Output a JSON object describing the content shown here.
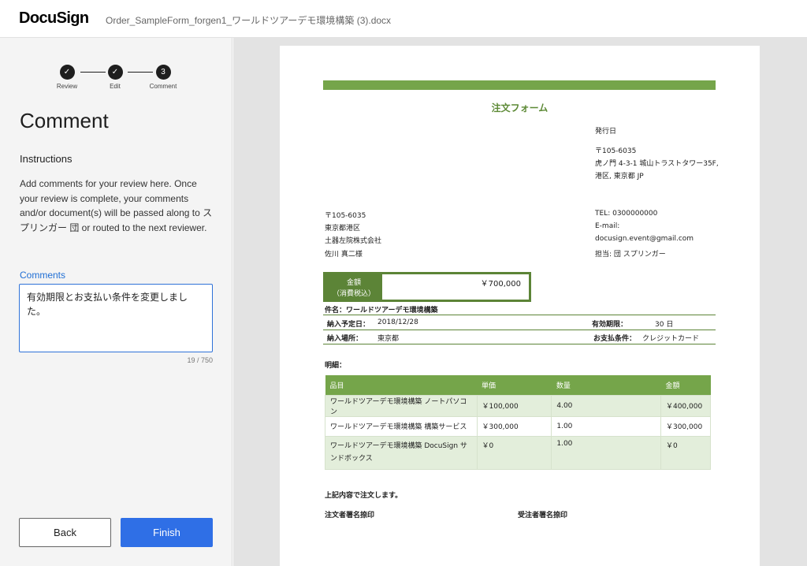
{
  "header": {
    "logo": "DocuSign",
    "filename": "Order_SampleForm_forgen1_ワールドツアーデモ環境構築 (3).docx"
  },
  "stepper": {
    "steps": [
      {
        "label": "Review",
        "state": "done",
        "glyph": "✓"
      },
      {
        "label": "Edit",
        "state": "done",
        "glyph": "✓"
      },
      {
        "label": "Comment",
        "state": "current",
        "glyph": "3"
      }
    ]
  },
  "sidebar": {
    "title": "Comment",
    "instructions_heading": "Instructions",
    "instructions": "Add comments for your review here. Once your review is complete, your comments and/or document(s) will be passed along to スプリンガー 団 or routed to the next reviewer.",
    "comments_label": "Comments",
    "comment_value": "有効期限とお支払い条件を変更しました。",
    "char_count": "19 / 750",
    "back_label": "Back",
    "finish_label": "Finish"
  },
  "document": {
    "title": "注文フォーム",
    "issue_date_label": "発行日",
    "sender_address": {
      "postal": "〒105-6035",
      "line1": "虎ノ門 4-3-1 城山トラストタワー35F,",
      "line2": "港区, 東京都 JP"
    },
    "recipient": {
      "postal": "〒105-6035",
      "city": "東京都港区",
      "company": "土器左院株式会社",
      "person": "佐川 真二様"
    },
    "contact": {
      "tel": "TEL: 0300000000",
      "email_label": "E-mail:",
      "email": "docusign.event@gmail.com",
      "person": "担当: 団 スプリンガー"
    },
    "amount": {
      "label": "金額",
      "tax_note": "（消費税込）",
      "value": "￥700,000"
    },
    "subject": "件名：ワールドツアーデモ環境構築",
    "delivery_date_label": "納入予定日：",
    "delivery_date": "2018/12/28",
    "validity_label": "有効期限：",
    "validity": "30 日",
    "delivery_place_label": "納入場所：",
    "delivery_place": "東京都",
    "payment_label": "お支払条件：",
    "payment": "クレジットカード",
    "details_label": "明細：",
    "table": {
      "headers": [
        "品目",
        "単価",
        "数量",
        "金額"
      ],
      "rows": [
        [
          "ワールドツアーデモ環境構築 ノートパソコン",
          "￥100,000",
          "4.00",
          "￥400,000"
        ],
        [
          "ワールドツアーデモ環境構築 構築サービス",
          "￥300,000",
          "1.00",
          "￥300,000"
        ],
        [
          "ワールドツアーデモ環境構築 DocuSign サンドボックス",
          "￥0",
          "1.00",
          "￥0"
        ]
      ]
    },
    "closing": "上記内容で注文します。",
    "orderer_sign": "注文者署名捺印",
    "receiver_sign": "受注者署名捺印"
  }
}
